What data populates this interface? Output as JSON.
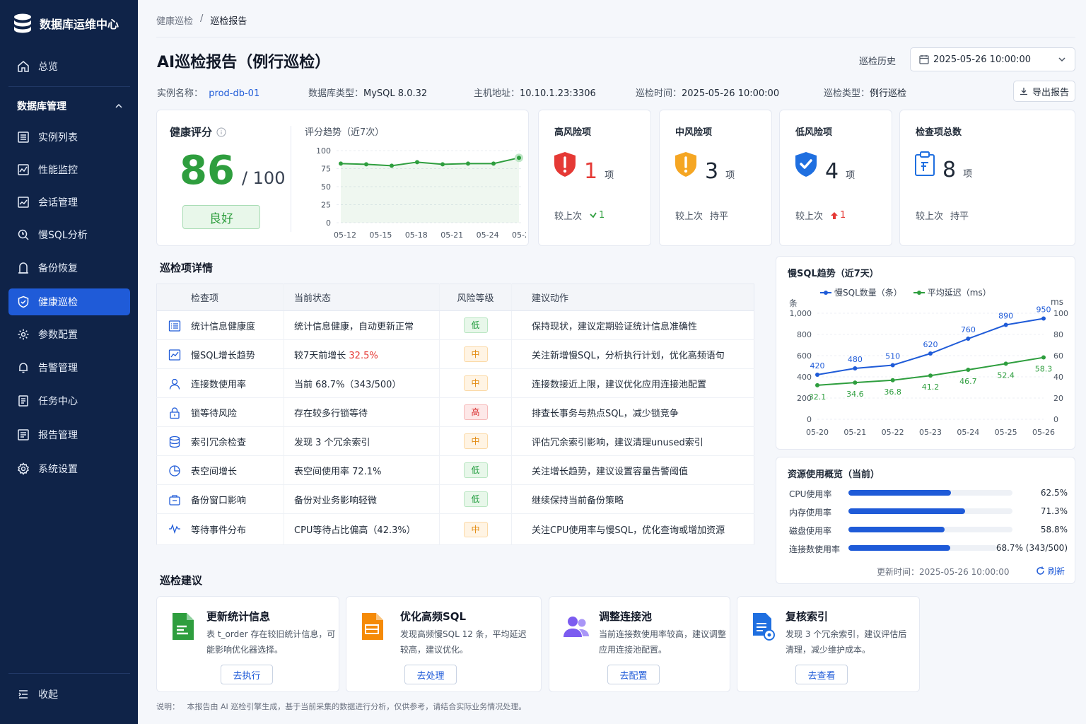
{
  "app": {
    "title": "数据库运维中心"
  },
  "nav": {
    "overview": "总览",
    "section_db": "数据库管理",
    "items": [
      "实例列表",
      "性能监控",
      "会话管理",
      "慢SQL分析",
      "备份恢复",
      "健康巡检",
      "参数配置",
      "告警管理",
      "任务中心",
      "报告管理",
      "系统设置"
    ],
    "active": "健康巡检",
    "collapse": "收起"
  },
  "breadcrumb": {
    "parent": "健康巡检",
    "sep": "/",
    "current": "巡检报告"
  },
  "header": {
    "title": "AI巡检报告（例行巡检）",
    "history_label": "巡检历史",
    "history_value": "2025-05-26 10:00:00",
    "export": "导出报告"
  },
  "meta": {
    "instance_label": "实例名称：",
    "instance": "prod-db-01",
    "dbtype_label": "数据库类型：",
    "dbtype": "MySQL 8.0.32",
    "host_label": "主机地址：",
    "host": "10.10.1.23:3306",
    "time_label": "巡检时间：",
    "time": "2025-05-26 10:00:00",
    "type_label": "巡检类型：",
    "type": "例行巡检"
  },
  "health": {
    "title": "健康评分",
    "score": "86",
    "total": "/ 100",
    "status": "良好",
    "trend_title": "评分趋势（近7次）"
  },
  "risks": [
    {
      "title": "高风险项",
      "num": "1",
      "unit": "项",
      "cmp_label": "较上次",
      "cmp_value": "1",
      "cmp_dir": "down",
      "color": "#e53935"
    },
    {
      "title": "中风险项",
      "num": "3",
      "unit": "项",
      "cmp_label": "较上次",
      "cmp_value": "持平",
      "cmp_dir": "none",
      "color": "#1f2937"
    },
    {
      "title": "低风险项",
      "num": "4",
      "unit": "项",
      "cmp_label": "较上次",
      "cmp_value": "1",
      "cmp_dir": "up",
      "color": "#1f2937"
    },
    {
      "title": "检查项总数",
      "num": "8",
      "unit": "项",
      "cmp_label": "较上次",
      "cmp_value": "持平",
      "cmp_dir": "none",
      "color": "#1f2937"
    }
  ],
  "details": {
    "title": "巡检项详情",
    "headers": [
      "检查项",
      "当前状态",
      "风险等级",
      "建议动作"
    ],
    "rows": [
      {
        "item": "统计信息健康度",
        "status": "统计信息健康，自动更新正常",
        "level": "低",
        "action": "保持现状，建议定期验证统计信息准确性"
      },
      {
        "item": "慢SQL增长趋势",
        "status": "较7天前增长 ",
        "status_hl": "32.5%",
        "level": "中",
        "action": "关注新增慢SQL，分析执行计划，优化高频语句"
      },
      {
        "item": "连接数使用率",
        "status": "当前 68.7%（343/500）",
        "level": "中",
        "action": "连接数接近上限，建议优化应用连接池配置"
      },
      {
        "item": "锁等待风险",
        "status": "存在较多行锁等待",
        "level": "高",
        "action": "排查长事务与热点SQL，减少锁竞争"
      },
      {
        "item": "索引冗余检查",
        "status": "发现 3 个冗余索引",
        "level": "中",
        "action": "评估冗余索引影响，建议清理unused索引"
      },
      {
        "item": "表空间增长",
        "status": "表空间使用率 72.1%",
        "level": "低",
        "action": "关注增长趋势，建议设置容量告警阈值"
      },
      {
        "item": "备份窗口影响",
        "status": "备份对业务影响轻微",
        "level": "低",
        "action": "继续保持当前备份策略"
      },
      {
        "item": "等待事件分布",
        "status": "CPU等待占比偏高（42.3%）",
        "level": "中",
        "action": "关注CPU使用率与慢SQL，优化查询或增加资源"
      }
    ]
  },
  "slow_sql": {
    "title": "慢SQL趋势（近7天）",
    "legend_count": "慢SQL数量（条）",
    "legend_latency": "平均延迟（ms）",
    "unit_left": "条",
    "unit_right": "ms"
  },
  "resources": {
    "title": "资源使用概览（当前）",
    "items": [
      {
        "label": "CPU使用率",
        "value": "62.5%",
        "pct": 62.5
      },
      {
        "label": "内存使用率",
        "value": "71.3%",
        "pct": 71.3
      },
      {
        "label": "磁盘使用率",
        "value": "58.8%",
        "pct": 58.8
      },
      {
        "label": "连接数使用率",
        "value": "68.7% (343/500)",
        "pct": 68.7
      }
    ],
    "updated_label": "更新时间：",
    "updated": "2025-05-26 10:00:00",
    "refresh": "刷新"
  },
  "suggestions": {
    "title": "巡检建议",
    "items": [
      {
        "title": "更新统计信息",
        "desc": "表 t_order 存在较旧统计信息，可能影响优化器选择。",
        "button": "去执行",
        "icon": "document-icon"
      },
      {
        "title": "优化高频SQL",
        "desc": "发现高频慢SQL 12 条，平均延迟较高，建议优化。",
        "button": "去处理",
        "icon": "sql-file-icon"
      },
      {
        "title": "调整连接池",
        "desc": "当前连接数使用率较高，建议调整应用连接池配置。",
        "button": "去配置",
        "icon": "users-icon"
      },
      {
        "title": "复核索引",
        "desc": "发现 3 个冗余索引，建议评估后清理，减少维护成本。",
        "button": "去查看",
        "icon": "index-file-icon"
      }
    ]
  },
  "footer": {
    "note": "说明：   本报告由 AI 巡检引擎生成，基于当前采集的数据进行分析，仅供参考，请结合实际业务情况处理。"
  },
  "chart_data": [
    {
      "type": "line",
      "title": "评分趋势（近7次）",
      "x": [
        "05-12",
        "05-15",
        "05-18",
        "05-21",
        "05-24",
        "05-26"
      ],
      "series": [
        {
          "values": [
            82,
            81,
            79,
            84,
            81,
            82,
            82,
            90
          ]
        }
      ],
      "ylim": [
        0,
        100
      ],
      "yticks": [
        0,
        25,
        50,
        75,
        100
      ],
      "grid": true
    },
    {
      "type": "line",
      "title": "慢SQL趋势（近7天）",
      "categories": [
        "05-20",
        "05-21",
        "05-22",
        "05-23",
        "05-24",
        "05-25",
        "05-26"
      ],
      "series": [
        {
          "name": "慢SQL数量（条）",
          "values": [
            420,
            480,
            510,
            620,
            760,
            890,
            950
          ],
          "axis": "left",
          "color": "#1f5bd8"
        },
        {
          "name": "平均延迟（ms）",
          "values": [
            32.1,
            34.6,
            36.8,
            41.2,
            46.7,
            52.4,
            58.3
          ],
          "axis": "right",
          "color": "#2e9e3e"
        }
      ],
      "ylim_left": [
        0,
        1000
      ],
      "yticks_left": [
        0,
        200,
        400,
        600,
        800,
        1000
      ],
      "yticklabels_left": [
        "0",
        "200",
        "400",
        "600",
        "800",
        "1,000"
      ],
      "ylim_right": [
        0,
        100
      ],
      "yticks_right": [
        0,
        20,
        40,
        60,
        80,
        100
      ],
      "legend": "top",
      "grid": true
    }
  ]
}
